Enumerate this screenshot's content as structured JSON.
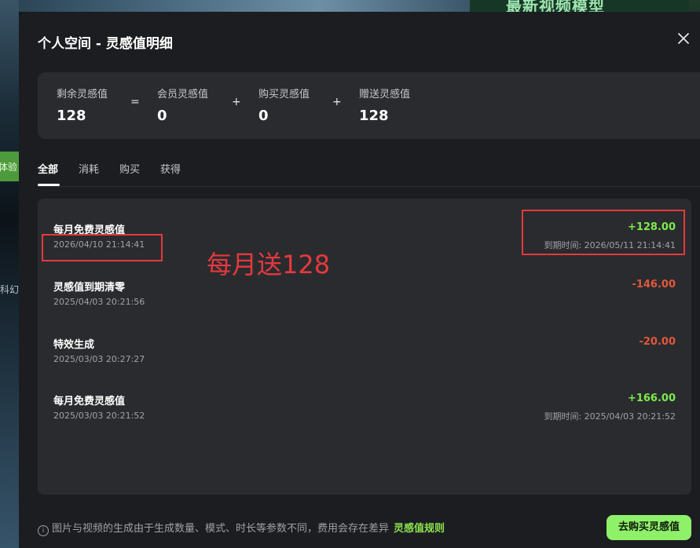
{
  "background": {
    "banner_text": "最新视频模型",
    "left_chip": "体验",
    "left_label": "科幻"
  },
  "modal": {
    "title": "个人空间 - 灵感值明细",
    "summary": [
      {
        "label": "剩余灵感值",
        "value": "128"
      },
      {
        "label": "会员灵感值",
        "value": "0"
      },
      {
        "label": "购买灵感值",
        "value": "0"
      },
      {
        "label": "赠送灵感值",
        "value": "128"
      }
    ],
    "operators": [
      "=",
      "+",
      "+"
    ],
    "tabs": [
      {
        "label": "全部",
        "active": true
      },
      {
        "label": "消耗",
        "active": false
      },
      {
        "label": "购买",
        "active": false
      },
      {
        "label": "获得",
        "active": false
      }
    ],
    "records": [
      {
        "title": "每月免费灵感值",
        "date": "2026/04/10 21:14:41",
        "amount": "+128.00",
        "expire": "到期时间:  2026/05/11 21:14:41"
      },
      {
        "title": "灵感值到期清零",
        "date": "2025/04/03 20:21:56",
        "amount": "-146.00",
        "expire": ""
      },
      {
        "title": "特效生成",
        "date": "2025/03/03 20:27:27",
        "amount": "-20.00",
        "expire": ""
      },
      {
        "title": "每月免费灵感值",
        "date": "2025/03/03 20:21:52",
        "amount": "+166.00",
        "expire": "到期时间:  2025/04/03 20:21:52"
      }
    ],
    "footer_note": "图片与视频的生成由于生成数量、模式、时长等参数不同，费用会存在差异",
    "rules_link": "灵感值规则",
    "buy_button": "去购买灵感值"
  },
  "annotation": {
    "text": "每月送128"
  },
  "colors": {
    "positive": "#7cec4c",
    "negative": "#e2573b",
    "accent": "#8ff06a",
    "annotation": "#e5393d"
  }
}
